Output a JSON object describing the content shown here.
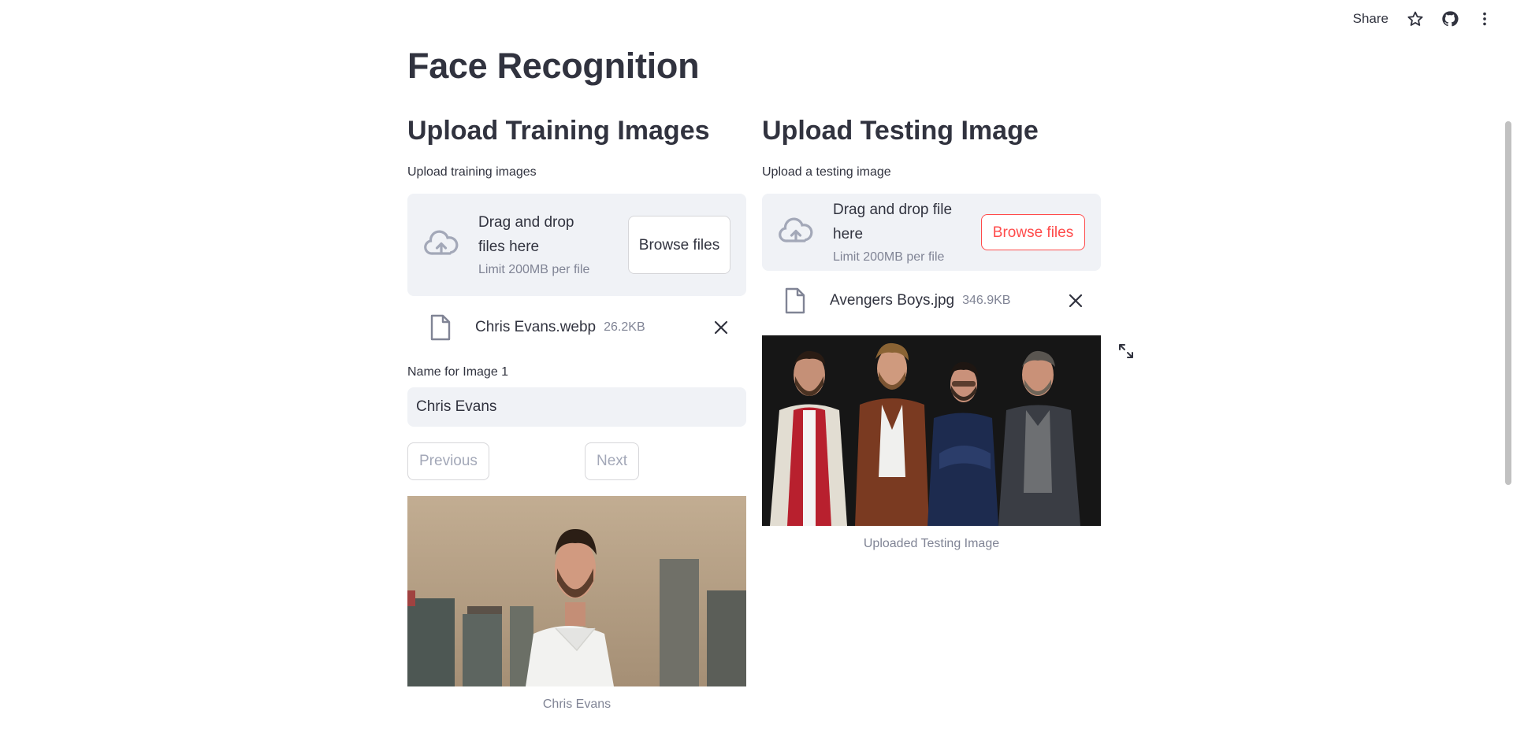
{
  "header": {
    "share_label": "Share",
    "icons": [
      "star-icon",
      "github-icon",
      "more-vertical-icon"
    ]
  },
  "title": "Face Recognition",
  "training": {
    "heading": "Upload Training Images",
    "uploader_label": "Upload training images",
    "drop_text": "Drag and drop files here",
    "limit_text": "Limit 200MB per file",
    "browse_label": "Browse files",
    "file": {
      "name": "Chris Evans.webp",
      "size": "26.2KB"
    },
    "name_label": "Name for Image 1",
    "name_value": "Chris Evans",
    "prev_label": "Previous",
    "next_label": "Next",
    "image_caption": "Chris Evans"
  },
  "testing": {
    "heading": "Upload Testing Image",
    "uploader_label": "Upload a testing image",
    "drop_text": "Drag and drop file here",
    "limit_text": "Limit 200MB per file",
    "browse_label": "Browse files",
    "file": {
      "name": "Avengers Boys.jpg",
      "size": "346.9KB"
    },
    "image_caption": "Uploaded Testing Image"
  },
  "colors": {
    "accent": "#ff4b4b",
    "text": "#31333f",
    "muted": "#808495",
    "surface": "#f0f2f6"
  }
}
